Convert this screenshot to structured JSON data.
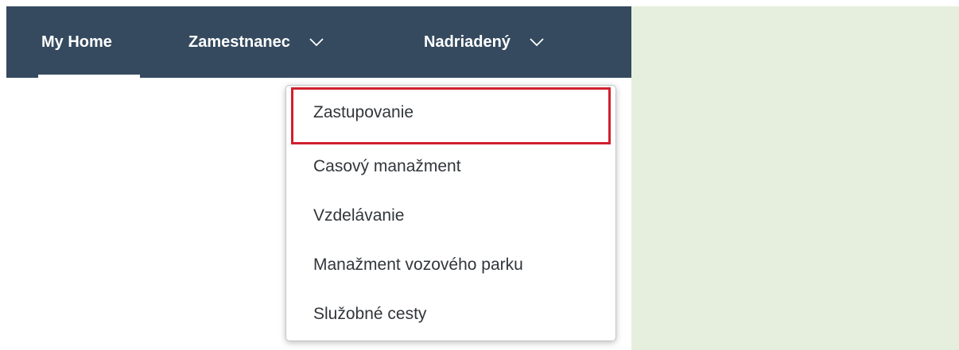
{
  "nav": {
    "home_label": "My Home",
    "zamestnanec_label": "Zamestnanec",
    "nadriadeny_label": "Nadriadený"
  },
  "menu": {
    "items": [
      {
        "label": "Zastupovanie",
        "highlighted": true
      },
      {
        "label": "Casový manažment"
      },
      {
        "label": "Vzdelávanie"
      },
      {
        "label": "Manažment vozového parku"
      },
      {
        "label": "Služobné cesty"
      }
    ]
  },
  "colors": {
    "topbar": "#354a5f",
    "highlight_border": "#d0202e",
    "right_area": "#e6efdd",
    "menu_text": "#32363a"
  },
  "icons": {
    "dropdown": "chevron-down-icon"
  }
}
